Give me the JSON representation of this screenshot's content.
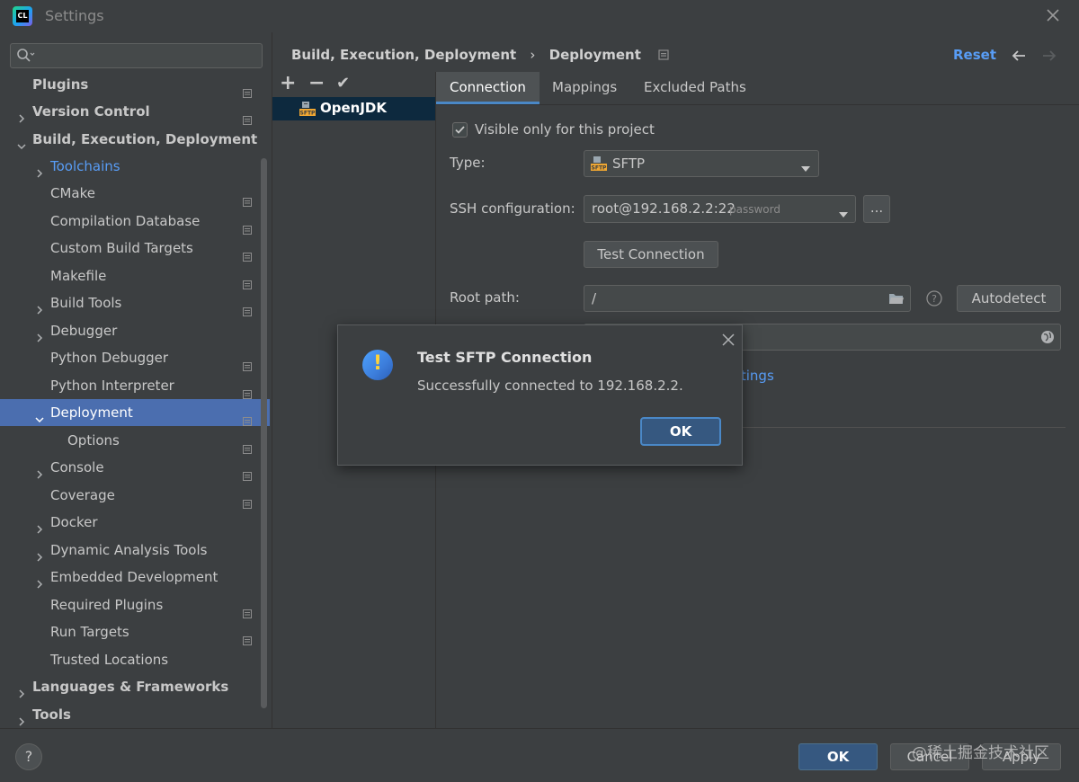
{
  "window": {
    "title": "Settings"
  },
  "search": {
    "value": ""
  },
  "sidebar": {
    "items": [
      {
        "label": "Plugins"
      },
      {
        "label": "Version Control"
      },
      {
        "label": "Build, Execution, Deployment"
      },
      {
        "label": "Toolchains"
      },
      {
        "label": "CMake"
      },
      {
        "label": "Compilation Database"
      },
      {
        "label": "Custom Build Targets"
      },
      {
        "label": "Makefile"
      },
      {
        "label": "Build Tools"
      },
      {
        "label": "Debugger"
      },
      {
        "label": "Python Debugger"
      },
      {
        "label": "Python Interpreter"
      },
      {
        "label": "Deployment"
      },
      {
        "label": "Options"
      },
      {
        "label": "Console"
      },
      {
        "label": "Coverage"
      },
      {
        "label": "Docker"
      },
      {
        "label": "Dynamic Analysis Tools"
      },
      {
        "label": "Embedded Development"
      },
      {
        "label": "Required Plugins"
      },
      {
        "label": "Run Targets"
      },
      {
        "label": "Trusted Locations"
      },
      {
        "label": "Languages & Frameworks"
      },
      {
        "label": "Tools"
      }
    ]
  },
  "header": {
    "crumb1": "Build, Execution, Deployment",
    "separator": "›",
    "crumb2": "Deployment",
    "reset": "Reset"
  },
  "servers": {
    "add": "+",
    "remove": "−",
    "default": "✔",
    "items": [
      {
        "name": "OpenJDK",
        "icon_text": "SFTP"
      }
    ]
  },
  "tabs": [
    {
      "label": "Connection"
    },
    {
      "label": "Mappings"
    },
    {
      "label": "Excluded Paths"
    }
  ],
  "form": {
    "visible_only_label": "Visible only for this project",
    "visible_only_checked": true,
    "type_label": "Type:",
    "type_value": "SFTP",
    "ssh_label": "SSH configuration:",
    "ssh_value": "root@192.168.2.2:22",
    "ssh_auth": "password",
    "ssh_more": "...",
    "test_connection": "Test Connection",
    "root_path_label": "Root path:",
    "root_path_value": "/",
    "autodetect": "Autodetect",
    "help": "?",
    "link_partial": "ttings"
  },
  "dialog": {
    "title": "Test SFTP Connection",
    "message": "Successfully connected to 192.168.2.2.",
    "ok": "OK"
  },
  "footer": {
    "help": "?",
    "ok": "OK",
    "cancel": "Cancel",
    "apply": "Apply",
    "watermark": "@稀土掘金技术社区"
  }
}
